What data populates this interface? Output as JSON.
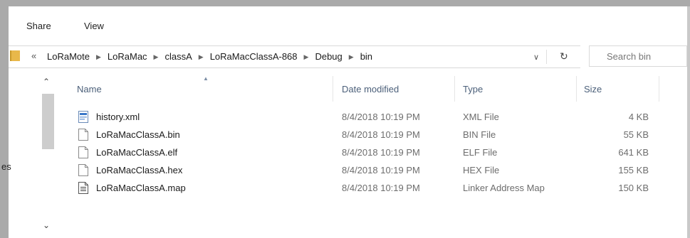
{
  "ribbon": {
    "tabs": [
      "Share",
      "View"
    ]
  },
  "address_bar": {
    "overflow": "«",
    "breadcrumbs": [
      "LoRaMote",
      "LoRaMac",
      "classA",
      "LoRaMacClassA-868",
      "Debug",
      "bin"
    ],
    "separator": "▶",
    "dropdown_glyph": "∨",
    "refresh_glyph": "↻"
  },
  "search": {
    "placeholder": "Search bin"
  },
  "nav_pane": {
    "partial_text": "es"
  },
  "columns": {
    "name": "Name",
    "date": "Date modified",
    "type": "Type",
    "size": "Size"
  },
  "files": [
    {
      "name": "history.xml",
      "date": "8/4/2018 10:19 PM",
      "type": "XML File",
      "size": "4 KB",
      "icon": "xml-file-icon"
    },
    {
      "name": "LoRaMacClassA.bin",
      "date": "8/4/2018 10:19 PM",
      "type": "BIN File",
      "size": "55 KB",
      "icon": "blank-file-icon"
    },
    {
      "name": "LoRaMacClassA.elf",
      "date": "8/4/2018 10:19 PM",
      "type": "ELF File",
      "size": "641 KB",
      "icon": "blank-file-icon"
    },
    {
      "name": "LoRaMacClassA.hex",
      "date": "8/4/2018 10:19 PM",
      "type": "HEX File",
      "size": "155 KB",
      "icon": "blank-file-icon"
    },
    {
      "name": "LoRaMacClassA.map",
      "date": "8/4/2018 10:19 PM",
      "type": "Linker Address Map",
      "size": "150 KB",
      "icon": "text-file-icon"
    }
  ],
  "colors": {
    "header_text": "#4c607a",
    "folder": "#e8b84a"
  }
}
